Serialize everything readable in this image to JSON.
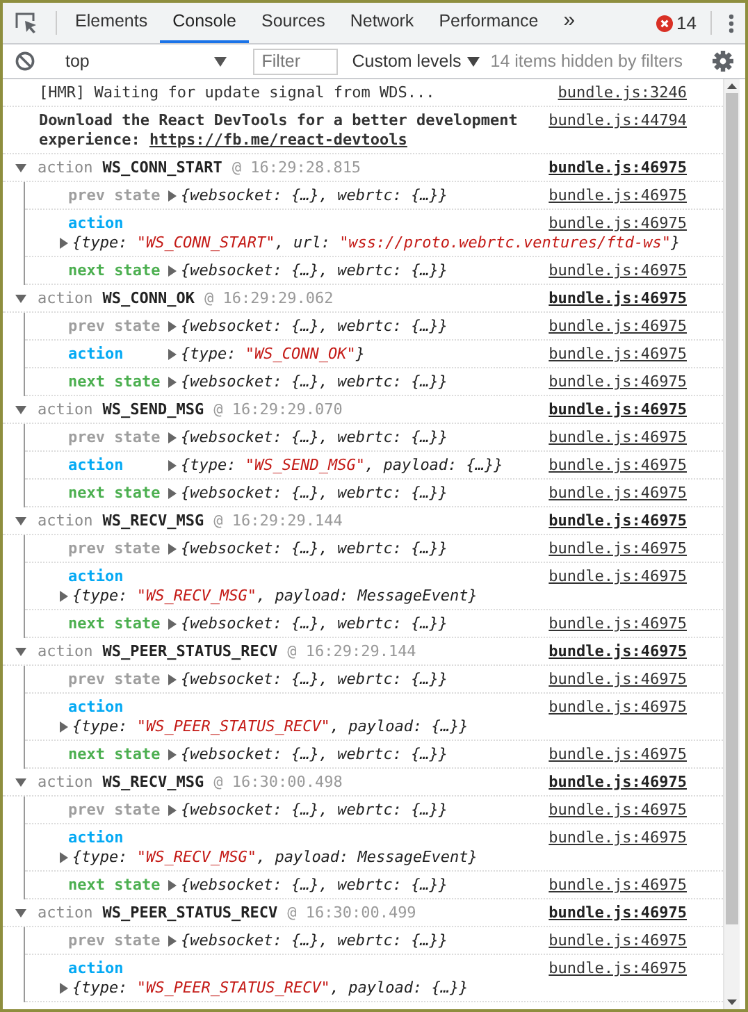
{
  "tabs": [
    {
      "label": "Elements",
      "selected": false
    },
    {
      "label": "Console",
      "selected": true
    },
    {
      "label": "Sources",
      "selected": false
    },
    {
      "label": "Network",
      "selected": false
    },
    {
      "label": "Performance",
      "selected": false
    }
  ],
  "more_tabs": "»",
  "error_count": "14",
  "toolbar": {
    "context": "top",
    "filter": {
      "placeholder": "Filter"
    },
    "levels": "Custom levels",
    "hidden_note": "14 items hidden by filters"
  },
  "messages": [
    {
      "kind": "log",
      "bold": false,
      "text": "[HMR] Waiting for update signal from WDS...",
      "source": "bundle.js:3246"
    },
    {
      "kind": "log",
      "bold": true,
      "text": "Download the React DevTools for a better development experience: ",
      "link": "https://fb.me/react-devtools",
      "source": "bundle.js:44794"
    },
    {
      "kind": "group",
      "expanded": true,
      "label": "action",
      "type": "WS_CONN_START",
      "time": "@ 16:29:28.815",
      "source": "bundle.js:46975",
      "entries": [
        {
          "kind": "prev",
          "label": "prev state",
          "expanded": false,
          "value": [
            {
              "kind": "plain",
              "text": "{websocket: {…}, webrtc: {…}}"
            }
          ],
          "source": "bundle.js:46975"
        },
        {
          "kind": "action",
          "label": "action",
          "expanded": false,
          "value": [
            {
              "kind": "plain",
              "text": "{type: "
            },
            {
              "kind": "string",
              "text": "\"WS_CONN_START\""
            },
            {
              "kind": "plain",
              "text": ", url: "
            },
            {
              "kind": "string",
              "text": "\"wss://proto.webrtc.ventures/ftd-ws\""
            },
            {
              "kind": "plain",
              "text": "}"
            }
          ],
          "source": "bundle.js:46975"
        },
        {
          "kind": "next",
          "label": "next state",
          "expanded": false,
          "value": [
            {
              "kind": "plain",
              "text": "{websocket: {…}, webrtc: {…}}"
            }
          ],
          "source": "bundle.js:46975"
        }
      ]
    },
    {
      "kind": "group",
      "expanded": true,
      "label": "action",
      "type": "WS_CONN_OK",
      "time": "@ 16:29:29.062",
      "source": "bundle.js:46975",
      "entries": [
        {
          "kind": "prev",
          "label": "prev state",
          "expanded": false,
          "value": [
            {
              "kind": "plain",
              "text": "{websocket: {…}, webrtc: {…}}"
            }
          ],
          "source": "bundle.js:46975"
        },
        {
          "kind": "action",
          "label": "action",
          "expanded": false,
          "value": [
            {
              "kind": "plain",
              "text": "{type: "
            },
            {
              "kind": "string",
              "text": "\"WS_CONN_OK\""
            },
            {
              "kind": "plain",
              "text": "}"
            }
          ],
          "source": "bundle.js:46975"
        },
        {
          "kind": "next",
          "label": "next state",
          "expanded": false,
          "value": [
            {
              "kind": "plain",
              "text": "{websocket: {…}, webrtc: {…}}"
            }
          ],
          "source": "bundle.js:46975"
        }
      ]
    },
    {
      "kind": "group",
      "expanded": true,
      "label": "action",
      "type": "WS_SEND_MSG",
      "time": "@ 16:29:29.070",
      "source": "bundle.js:46975",
      "entries": [
        {
          "kind": "prev",
          "label": "prev state",
          "expanded": false,
          "value": [
            {
              "kind": "plain",
              "text": "{websocket: {…}, webrtc: {…}}"
            }
          ],
          "source": "bundle.js:46975"
        },
        {
          "kind": "action",
          "label": "action",
          "expanded": false,
          "value": [
            {
              "kind": "plain",
              "text": "{type: "
            },
            {
              "kind": "string",
              "text": "\"WS_SEND_MSG\""
            },
            {
              "kind": "plain",
              "text": ", payload: {…}}"
            }
          ],
          "source": "bundle.js:46975"
        },
        {
          "kind": "next",
          "label": "next state",
          "expanded": false,
          "value": [
            {
              "kind": "plain",
              "text": "{websocket: {…}, webrtc: {…}}"
            }
          ],
          "source": "bundle.js:46975"
        }
      ]
    },
    {
      "kind": "group",
      "expanded": true,
      "label": "action",
      "type": "WS_RECV_MSG",
      "time": "@ 16:29:29.144",
      "source": "bundle.js:46975",
      "entries": [
        {
          "kind": "prev",
          "label": "prev state",
          "expanded": false,
          "value": [
            {
              "kind": "plain",
              "text": "{websocket: {…}, webrtc: {…}}"
            }
          ],
          "source": "bundle.js:46975"
        },
        {
          "kind": "action",
          "label": "action",
          "expanded": false,
          "value": [
            {
              "kind": "plain",
              "text": "{type: "
            },
            {
              "kind": "string",
              "text": "\"WS_RECV_MSG\""
            },
            {
              "kind": "plain",
              "text": ", payload: MessageEvent}"
            }
          ],
          "source": "bundle.js:46975"
        },
        {
          "kind": "next",
          "label": "next state",
          "expanded": false,
          "value": [
            {
              "kind": "plain",
              "text": "{websocket: {…}, webrtc: {…}}"
            }
          ],
          "source": "bundle.js:46975"
        }
      ]
    },
    {
      "kind": "group",
      "expanded": true,
      "label": "action",
      "type": "WS_PEER_STATUS_RECV",
      "time": "@ 16:29:29.144",
      "source": "bundle.js:46975",
      "entries": [
        {
          "kind": "prev",
          "label": "prev state",
          "expanded": false,
          "value": [
            {
              "kind": "plain",
              "text": "{websocket: {…}, webrtc: {…}}"
            }
          ],
          "source": "bundle.js:46975"
        },
        {
          "kind": "action",
          "label": "action",
          "expanded": false,
          "value": [
            {
              "kind": "plain",
              "text": "{type: "
            },
            {
              "kind": "string",
              "text": "\"WS_PEER_STATUS_RECV\""
            },
            {
              "kind": "plain",
              "text": ", payload: {…}}"
            }
          ],
          "source": "bundle.js:46975"
        },
        {
          "kind": "next",
          "label": "next state",
          "expanded": false,
          "value": [
            {
              "kind": "plain",
              "text": "{websocket: {…}, webrtc: {…}}"
            }
          ],
          "source": "bundle.js:46975"
        }
      ]
    },
    {
      "kind": "group",
      "expanded": true,
      "label": "action",
      "type": "WS_RECV_MSG",
      "time": "@ 16:30:00.498",
      "source": "bundle.js:46975",
      "entries": [
        {
          "kind": "prev",
          "label": "prev state",
          "expanded": false,
          "value": [
            {
              "kind": "plain",
              "text": "{websocket: {…}, webrtc: {…}}"
            }
          ],
          "source": "bundle.js:46975"
        },
        {
          "kind": "action",
          "label": "action",
          "expanded": false,
          "value": [
            {
              "kind": "plain",
              "text": "{type: "
            },
            {
              "kind": "string",
              "text": "\"WS_RECV_MSG\""
            },
            {
              "kind": "plain",
              "text": ", payload: MessageEvent}"
            }
          ],
          "source": "bundle.js:46975"
        },
        {
          "kind": "next",
          "label": "next state",
          "expanded": false,
          "value": [
            {
              "kind": "plain",
              "text": "{websocket: {…}, webrtc: {…}}"
            }
          ],
          "source": "bundle.js:46975"
        }
      ]
    },
    {
      "kind": "group",
      "expanded": true,
      "label": "action",
      "type": "WS_PEER_STATUS_RECV",
      "time": "@ 16:30:00.499",
      "source": "bundle.js:46975",
      "entries": [
        {
          "kind": "prev",
          "label": "prev state",
          "expanded": false,
          "value": [
            {
              "kind": "plain",
              "text": "{websocket: {…}, webrtc: {…}}"
            }
          ],
          "source": "bundle.js:46975"
        },
        {
          "kind": "action",
          "label": "action",
          "expanded": false,
          "value": [
            {
              "kind": "plain",
              "text": "{type: "
            },
            {
              "kind": "string",
              "text": "\"WS_PEER_STATUS_RECV\""
            },
            {
              "kind": "plain",
              "text": ", payload: {…}}"
            }
          ],
          "source": "bundle.js:46975"
        }
      ]
    }
  ]
}
